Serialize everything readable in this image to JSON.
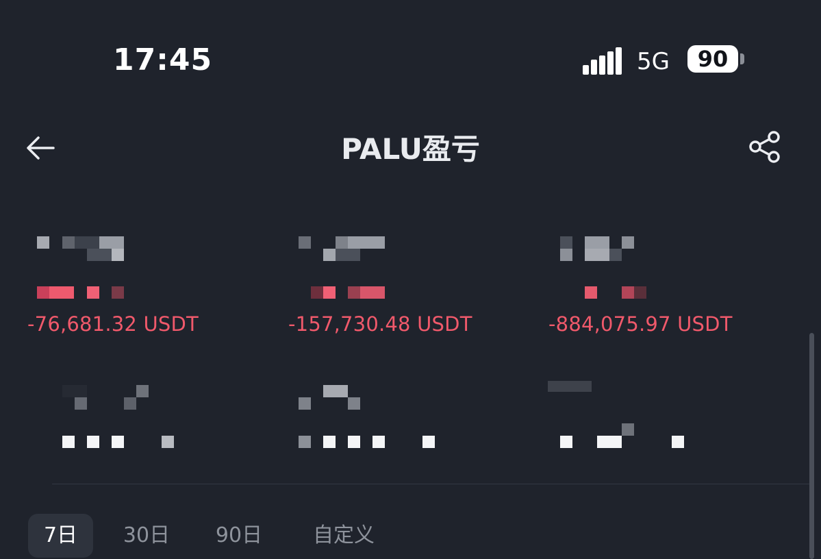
{
  "status_bar": {
    "time": "17:45",
    "network": "5G",
    "battery": "90"
  },
  "header": {
    "title": "PALU盈亏",
    "back_icon": "arrow-left-icon",
    "share_icon": "share-icon"
  },
  "stats": {
    "pnl_values": [
      "-76,681.32 USDT",
      "-157,730.48 USDT",
      "-884,075.97 USDT"
    ]
  },
  "tabs": [
    {
      "label": "7日",
      "active": true
    },
    {
      "label": "30日",
      "active": false
    },
    {
      "label": "90日",
      "active": false
    },
    {
      "label": "自定义",
      "active": false
    }
  ],
  "colors": {
    "background": "#1f232c",
    "loss": "#f0596b",
    "tab_active_bg": "#2e333d"
  }
}
